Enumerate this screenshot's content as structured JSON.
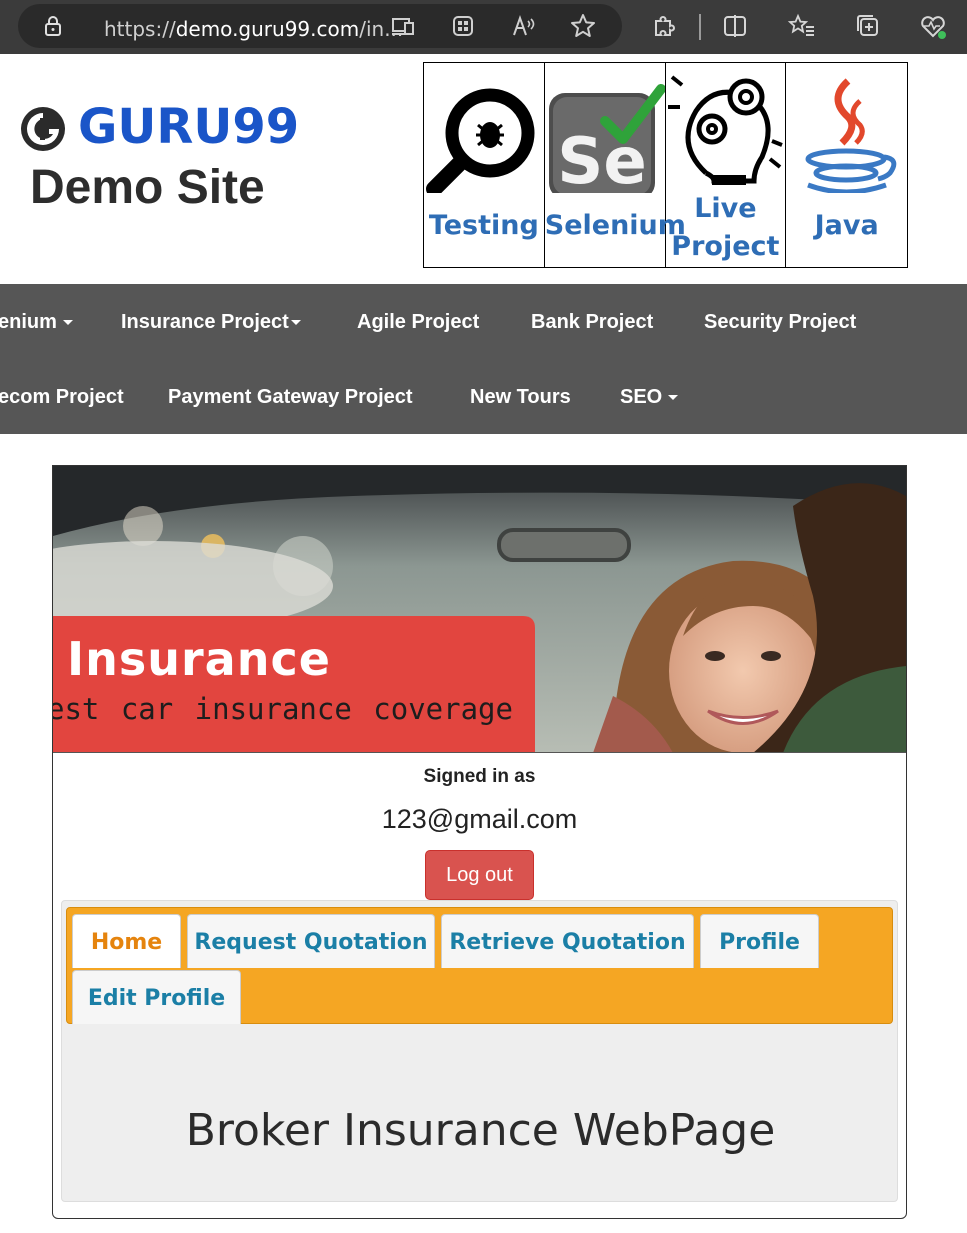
{
  "browser": {
    "url_prefix": "https://",
    "url_host": "demo.guru99.com",
    "url_rest": "/in..."
  },
  "header": {
    "logo_text": "GURU99",
    "site_title": "Demo Site",
    "courses": [
      {
        "label_line1": "Testing",
        "label_line2": ""
      },
      {
        "label_line1": "Selenium",
        "label_line2": ""
      },
      {
        "label_line1": "Live",
        "label_line2": "Project"
      },
      {
        "label_line1": "Java",
        "label_line2": ""
      }
    ]
  },
  "nav": {
    "row1": [
      "enium",
      "Insurance Project",
      "Agile Project",
      "Bank Project",
      "Security Project"
    ],
    "row2": [
      "ecom Project",
      "Payment Gateway Project",
      "New Tours",
      "SEO"
    ]
  },
  "hero": {
    "title": "Insurance",
    "subtitle": "est car insurance coverage"
  },
  "account": {
    "signed_label": "Signed in as",
    "email": "123@gmail.com",
    "logout_label": "Log out"
  },
  "tabs": [
    {
      "label": "Home",
      "active": true
    },
    {
      "label": "Request Quotation",
      "active": false
    },
    {
      "label": "Retrieve Quotation",
      "active": false
    },
    {
      "label": "Profile",
      "active": false
    },
    {
      "label": "Edit Profile",
      "active": false
    }
  ],
  "content": {
    "heading": "Broker Insurance WebPage"
  },
  "colors": {
    "nav_bg": "#565656",
    "tab_bar": "#f5a623",
    "logout": "#d9534f",
    "brand_blue": "#1a55c8",
    "active_tab_text": "#e5840e",
    "tab_text": "#1b7fa6"
  }
}
